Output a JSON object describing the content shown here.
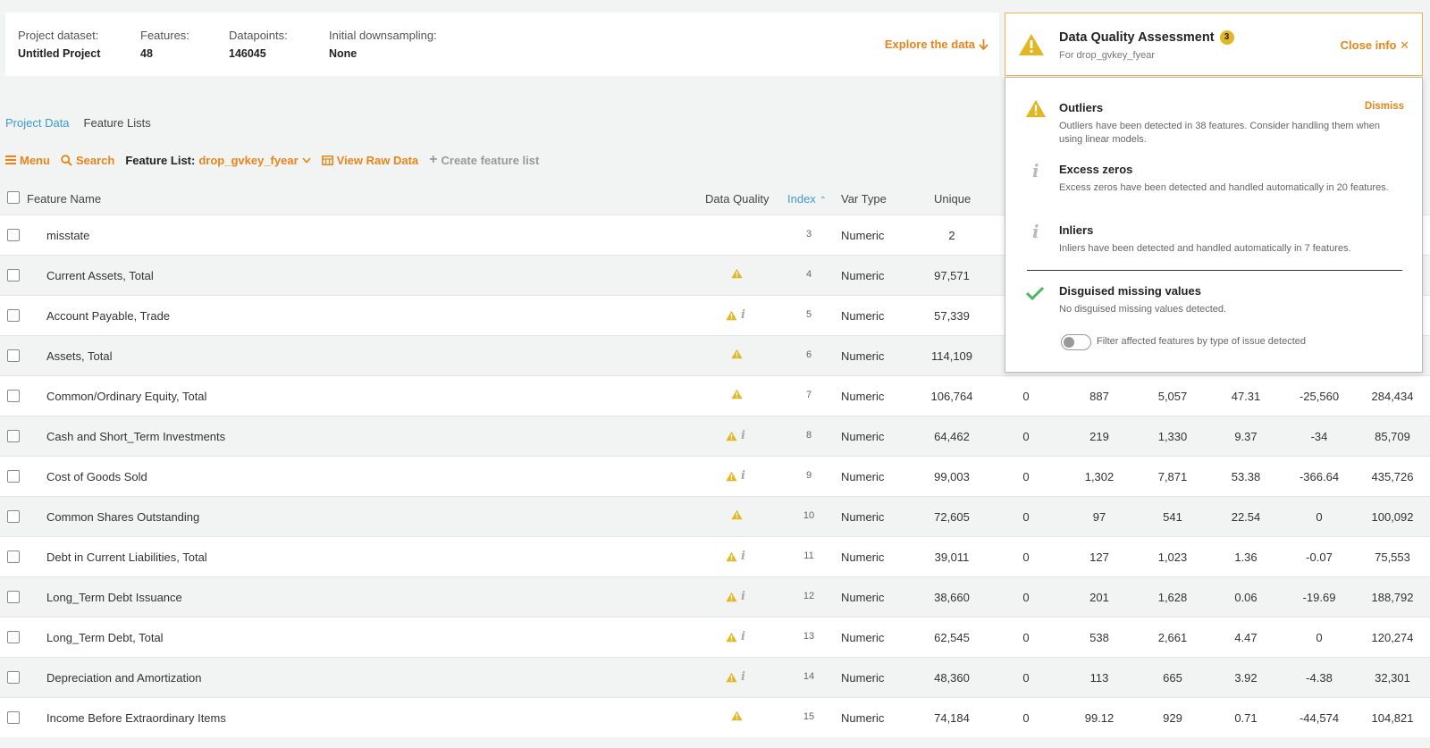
{
  "info": {
    "dataset_label": "Project dataset:",
    "dataset_value": "Untitled Project",
    "features_label": "Features:",
    "features_value": "48",
    "datapoints_label": "Datapoints:",
    "datapoints_value": "146045",
    "downsampling_label": "Initial downsampling:",
    "downsampling_value": "None",
    "explore_label": "Explore the data"
  },
  "dqa": {
    "title": "Data Quality Assessment",
    "count": "3",
    "subtitle": "For drop_gvkey_fyear",
    "close_label": "Close info",
    "dismiss_label": "Dismiss",
    "issues": [
      {
        "title": "Outliers",
        "desc": "Outliers have been detected in 38 features. Consider handling them when using linear models."
      },
      {
        "title": "Excess zeros",
        "desc": "Excess zeros have been detected and handled automatically in 20 features."
      },
      {
        "title": "Inliers",
        "desc": "Inliers have been detected and handled automatically in 7 features."
      },
      {
        "title": "Disguised missing values",
        "desc": "No disguised missing values detected."
      }
    ],
    "toggle_label": "Filter affected features by type of issue detected",
    "colors": {
      "warning": "#e3b623",
      "check": "#4cb85c",
      "accent": "#e8841a"
    }
  },
  "tabs": {
    "project_data": "Project Data",
    "feature_lists": "Feature Lists"
  },
  "toolbar": {
    "menu": "Menu",
    "search": "Search",
    "feature_list_label": "Feature List:",
    "feature_list_value": "drop_gvkey_fyear",
    "view_raw": "View Raw Data",
    "create_list": "Create feature list"
  },
  "table": {
    "headers": {
      "name": "Feature Name",
      "quality": "Data Quality",
      "index": "Index",
      "type": "Var Type",
      "unique": "Unique"
    },
    "rows": [
      {
        "name": "misstate",
        "warn": false,
        "info": false,
        "index": "3",
        "type": "Numeric",
        "unique": "2",
        "c1": "",
        "c2": "",
        "c3": "",
        "c4": "",
        "c5": "",
        "c6": ""
      },
      {
        "name": "Current Assets, Total",
        "warn": true,
        "info": false,
        "index": "4",
        "type": "Numeric",
        "unique": "97,571",
        "c1": "",
        "c2": "",
        "c3": "",
        "c4": "",
        "c5": "",
        "c6": ""
      },
      {
        "name": "Account Payable, Trade",
        "warn": true,
        "info": true,
        "index": "5",
        "type": "Numeric",
        "unique": "57,339",
        "c1": "",
        "c2": "",
        "c3": "",
        "c4": "",
        "c5": "",
        "c6": ""
      },
      {
        "name": "Assets, Total",
        "warn": true,
        "info": false,
        "index": "6",
        "type": "Numeric",
        "unique": "114,109",
        "c1": "",
        "c2": "",
        "c3": "",
        "c4": "",
        "c5": "",
        "c6": ""
      },
      {
        "name": "Common/Ordinary Equity, Total",
        "warn": true,
        "info": false,
        "index": "7",
        "type": "Numeric",
        "unique": "106,764",
        "c1": "0",
        "c2": "887",
        "c3": "5,057",
        "c4": "47.31",
        "c5": "-25,560",
        "c6": "284,434"
      },
      {
        "name": "Cash and Short_Term Investments",
        "warn": true,
        "info": true,
        "index": "8",
        "type": "Numeric",
        "unique": "64,462",
        "c1": "0",
        "c2": "219",
        "c3": "1,330",
        "c4": "9.37",
        "c5": "-34",
        "c6": "85,709"
      },
      {
        "name": "Cost of Goods Sold",
        "warn": true,
        "info": true,
        "index": "9",
        "type": "Numeric",
        "unique": "99,003",
        "c1": "0",
        "c2": "1,302",
        "c3": "7,871",
        "c4": "53.38",
        "c5": "-366.64",
        "c6": "435,726"
      },
      {
        "name": "Common Shares Outstanding",
        "warn": true,
        "info": false,
        "index": "10",
        "type": "Numeric",
        "unique": "72,605",
        "c1": "0",
        "c2": "97",
        "c3": "541",
        "c4": "22.54",
        "c5": "0",
        "c6": "100,092"
      },
      {
        "name": "Debt in Current Liabilities, Total",
        "warn": true,
        "info": true,
        "index": "11",
        "type": "Numeric",
        "unique": "39,011",
        "c1": "0",
        "c2": "127",
        "c3": "1,023",
        "c4": "1.36",
        "c5": "-0.07",
        "c6": "75,553"
      },
      {
        "name": "Long_Term Debt Issuance",
        "warn": true,
        "info": true,
        "index": "12",
        "type": "Numeric",
        "unique": "38,660",
        "c1": "0",
        "c2": "201",
        "c3": "1,628",
        "c4": "0.06",
        "c5": "-19.69",
        "c6": "188,792"
      },
      {
        "name": "Long_Term Debt, Total",
        "warn": true,
        "info": true,
        "index": "13",
        "type": "Numeric",
        "unique": "62,545",
        "c1": "0",
        "c2": "538",
        "c3": "2,661",
        "c4": "4.47",
        "c5": "0",
        "c6": "120,274"
      },
      {
        "name": "Depreciation and Amortization",
        "warn": true,
        "info": true,
        "index": "14",
        "type": "Numeric",
        "unique": "48,360",
        "c1": "0",
        "c2": "113",
        "c3": "665",
        "c4": "3.92",
        "c5": "-4.38",
        "c6": "32,301"
      },
      {
        "name": "Income Before Extraordinary Items",
        "warn": true,
        "info": false,
        "index": "15",
        "type": "Numeric",
        "unique": "74,184",
        "c1": "0",
        "c2": "99.12",
        "c3": "929",
        "c4": "0.71",
        "c5": "-44,574",
        "c6": "104,821"
      }
    ]
  }
}
